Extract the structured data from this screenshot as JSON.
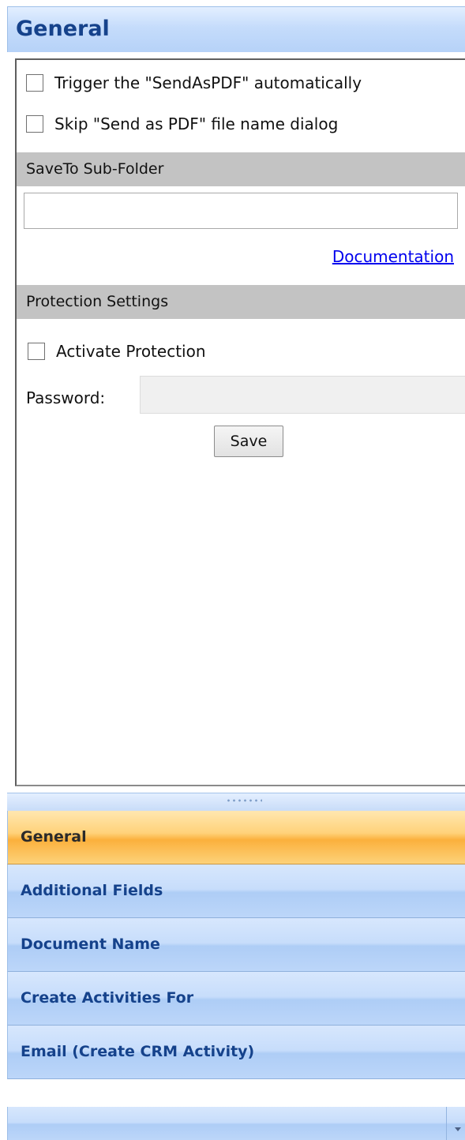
{
  "header": {
    "title": "General"
  },
  "options": {
    "trigger_auto_label": "Trigger the \"SendAsPDF\" automatically",
    "trigger_auto_checked": false,
    "skip_dialog_label": "Skip \"Send as PDF\" file name dialog",
    "skip_dialog_checked": false
  },
  "save_to": {
    "section_title": "SaveTo Sub-Folder",
    "value": "",
    "documentation_link": "Documentation"
  },
  "protection": {
    "section_title": "Protection Settings",
    "activate_label": "Activate Protection",
    "activate_checked": false,
    "password_label": "Password:",
    "password_value": "",
    "save_label": "Save"
  },
  "navigation": {
    "items": [
      {
        "label": "General",
        "active": true
      },
      {
        "label": "Additional Fields",
        "active": false
      },
      {
        "label": "Document Name",
        "active": false
      },
      {
        "label": "Create Activities For",
        "active": false
      },
      {
        "label": "Email (Create CRM Activity)",
        "active": false
      }
    ],
    "overflow_icon": "chevron-down-icon"
  },
  "colors": {
    "header_text": "#15428b",
    "active_nav": "#fbb03c",
    "nav_blue": "#c7ddfb",
    "section_bar": "#c3c3c3",
    "link": "#0000ee"
  }
}
